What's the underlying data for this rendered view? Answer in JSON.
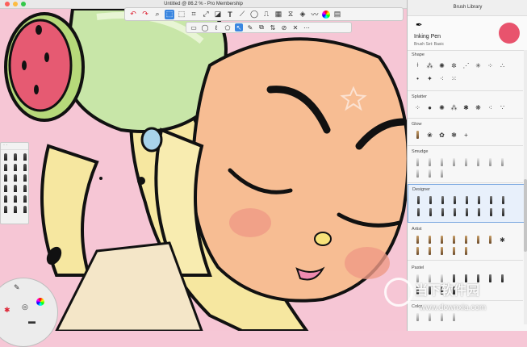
{
  "window": {
    "title": "Untitled @ 86.2 % - Pro Membership"
  },
  "toolbar": {
    "tools": [
      {
        "name": "undo",
        "glyph": "↶"
      },
      {
        "name": "redo",
        "glyph": "↷"
      },
      {
        "name": "zoom",
        "glyph": "🔍"
      },
      {
        "name": "select",
        "glyph": "⬚"
      },
      {
        "name": "crop",
        "glyph": "⌗"
      },
      {
        "name": "transform",
        "glyph": "⤢"
      },
      {
        "name": "distort",
        "glyph": "◪"
      },
      {
        "name": "text",
        "glyph": "T"
      },
      {
        "name": "ruler",
        "glyph": "⟋"
      },
      {
        "name": "ellipse",
        "glyph": "◯"
      },
      {
        "name": "symmetry",
        "glyph": "⎍"
      },
      {
        "name": "perspective",
        "glyph": "▦"
      },
      {
        "name": "flood-fill",
        "glyph": "◈"
      },
      {
        "name": "color-wheel",
        "glyph": "◉"
      },
      {
        "name": "layers",
        "glyph": "▤"
      }
    ]
  },
  "select_bar": {
    "tools": [
      {
        "name": "rect-select",
        "glyph": "▭"
      },
      {
        "name": "oval-select",
        "glyph": "◯"
      },
      {
        "name": "lasso",
        "glyph": "ℓ"
      },
      {
        "name": "polygon-select",
        "glyph": "⬠"
      },
      {
        "name": "magic-wand",
        "glyph": "↖"
      },
      {
        "name": "invert",
        "glyph": "⇅"
      },
      {
        "name": "clear",
        "glyph": "⊘"
      },
      {
        "name": "brush-select",
        "glyph": "✎"
      },
      {
        "name": "deselect",
        "glyph": "✕"
      }
    ]
  },
  "library": {
    "title": "Brush Library",
    "current_brush": "Inking Pen",
    "brush_set": "Brush Set: Basic",
    "current_color": "#e8536d",
    "sections": [
      {
        "label": "Shape"
      },
      {
        "label": "Splatter"
      },
      {
        "label": "Glow"
      },
      {
        "label": "Smudge"
      },
      {
        "label": "Designer"
      },
      {
        "label": "Artist"
      },
      {
        "label": "Pastel"
      },
      {
        "label": "Color"
      }
    ]
  },
  "watermark": {
    "cn": "当下软件园",
    "url": "www.downxia.com"
  }
}
